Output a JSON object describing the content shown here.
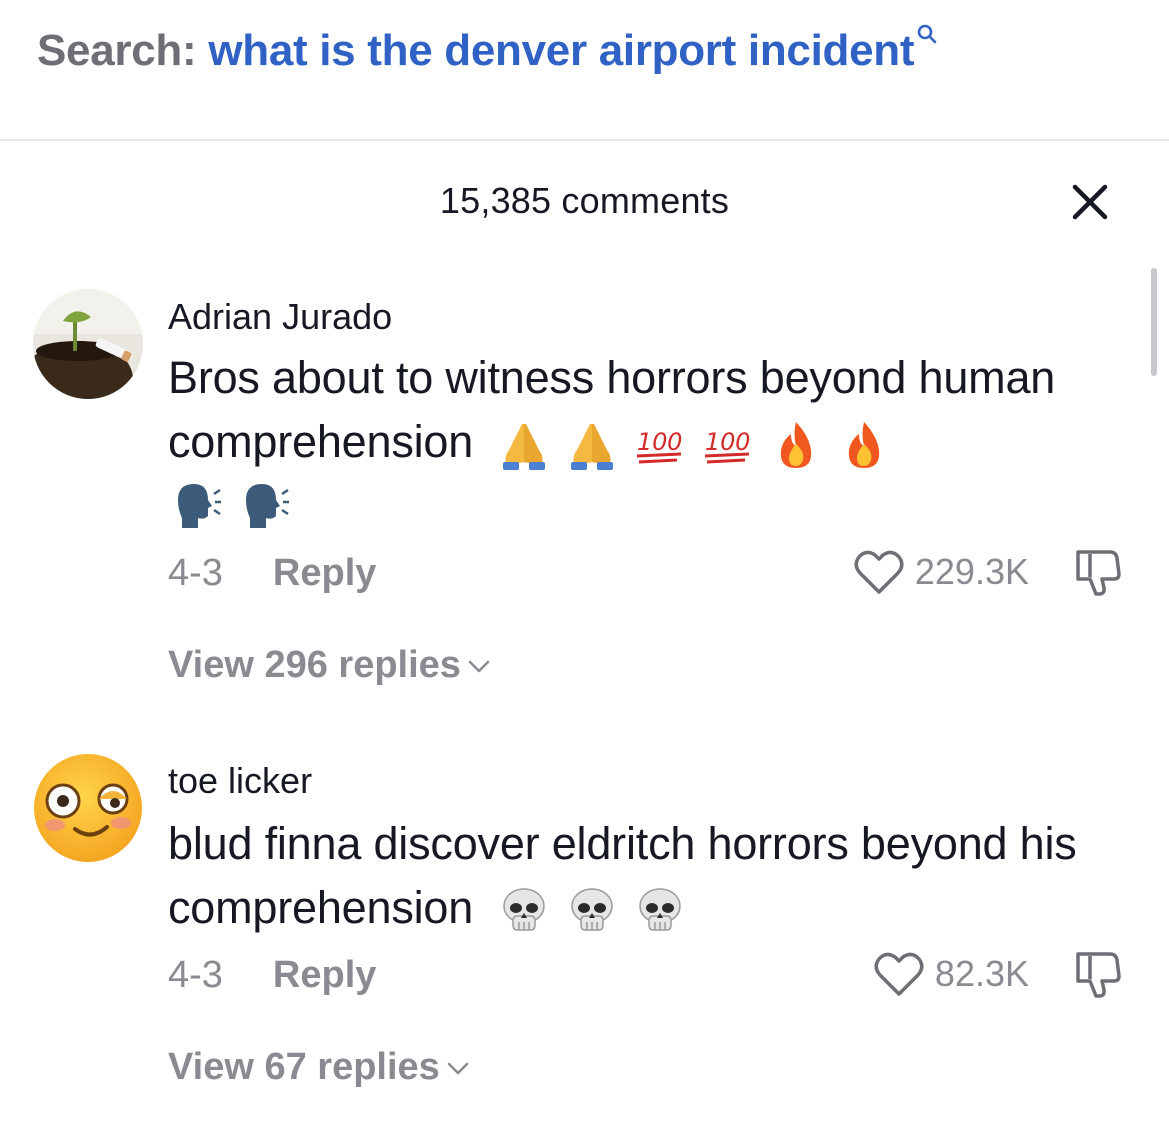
{
  "search": {
    "prefix": "Search:",
    "query": "what is the denver airport incident"
  },
  "comments_header": {
    "count_label": "15,385 comments"
  },
  "comments": [
    {
      "username": "Adrian Jurado",
      "text": "Bros about to witness horrors beyond human comprehension",
      "emojis": [
        "folded-hands",
        "folded-hands",
        "hundred-points",
        "hundred-points",
        "fire",
        "fire",
        "speaking-head",
        "speaking-head"
      ],
      "date": "4-3",
      "reply_label": "Reply",
      "likes": "229.3K",
      "view_replies": "View 296 replies"
    },
    {
      "username": "toe licker",
      "text": "blud finna discover eldritch horrors beyond his comprehension",
      "emojis": [
        "skull",
        "skull",
        "skull"
      ],
      "date": "4-3",
      "reply_label": "Reply",
      "likes": "82.3K",
      "view_replies": "View 67 replies"
    }
  ],
  "colors": {
    "search_prefix": "#6e6f74",
    "search_query": "#2f62c4",
    "text_primary": "#161823",
    "text_secondary": "#8a8b91"
  }
}
